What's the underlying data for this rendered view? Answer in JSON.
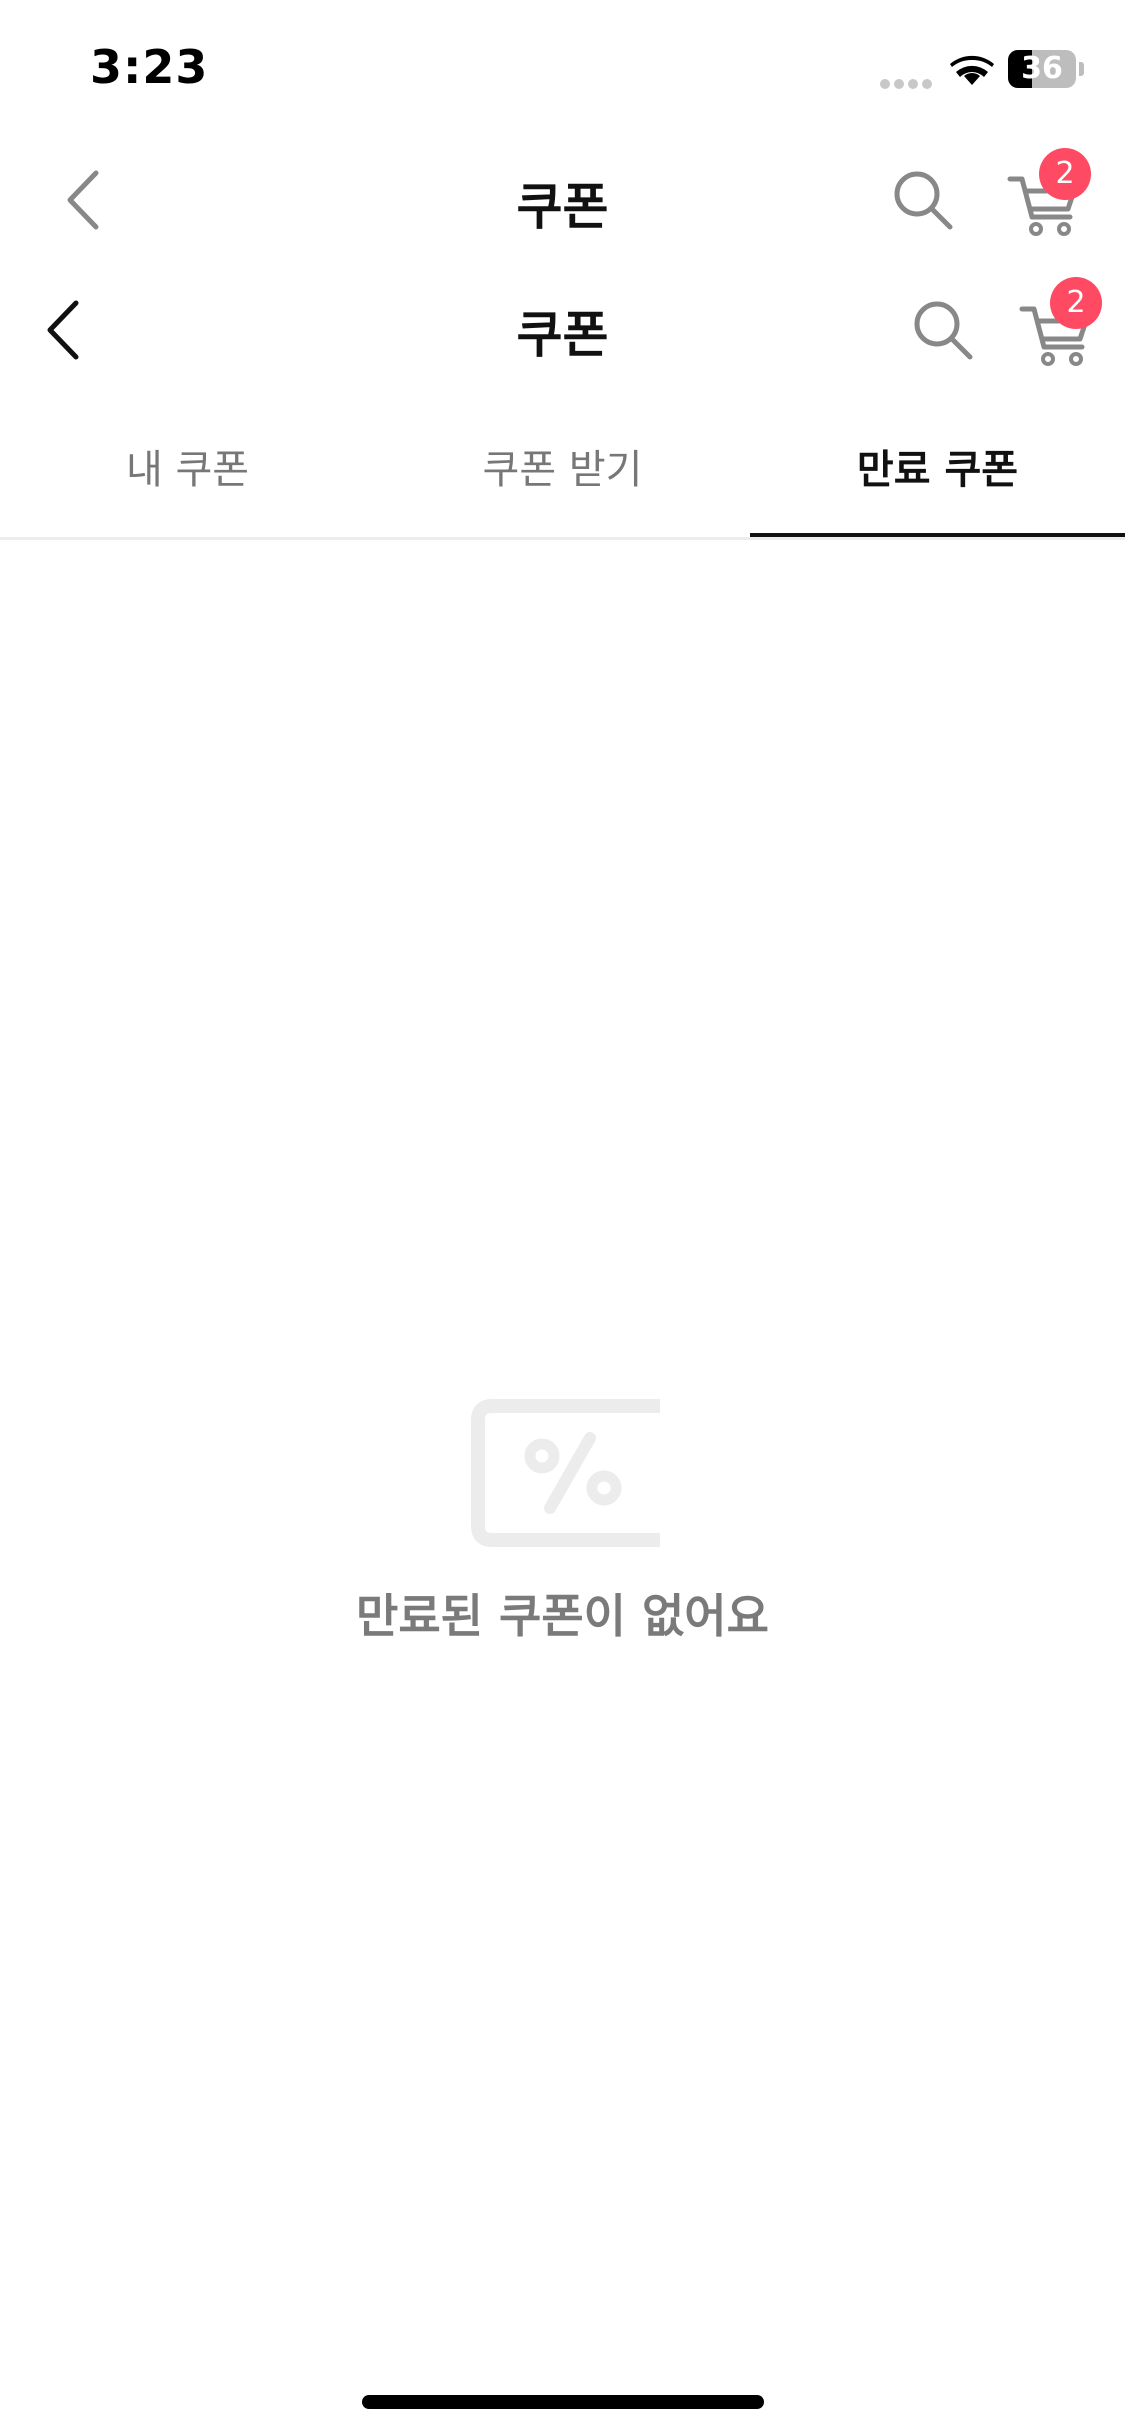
{
  "status_bar": {
    "time": "3:23",
    "battery_percent": "36",
    "battery_level": 0.36
  },
  "header_1": {
    "title": "쿠폰",
    "cart_badge": "2"
  },
  "header_2": {
    "title": "쿠폰",
    "cart_badge": "2"
  },
  "tabs": [
    {
      "label": "내 쿠폰",
      "active": false
    },
    {
      "label": "쿠폰 받기",
      "active": false
    },
    {
      "label": "만료 쿠폰",
      "active": true
    }
  ],
  "empty_state": {
    "message": "만료된 쿠폰이 없어요",
    "icon": "coupon-percent-icon"
  },
  "colors": {
    "accent_badge": "#ff4a63",
    "active_tab": "#111111",
    "inactive_tab": "#777777",
    "empty_text": "#7a7a7a"
  }
}
